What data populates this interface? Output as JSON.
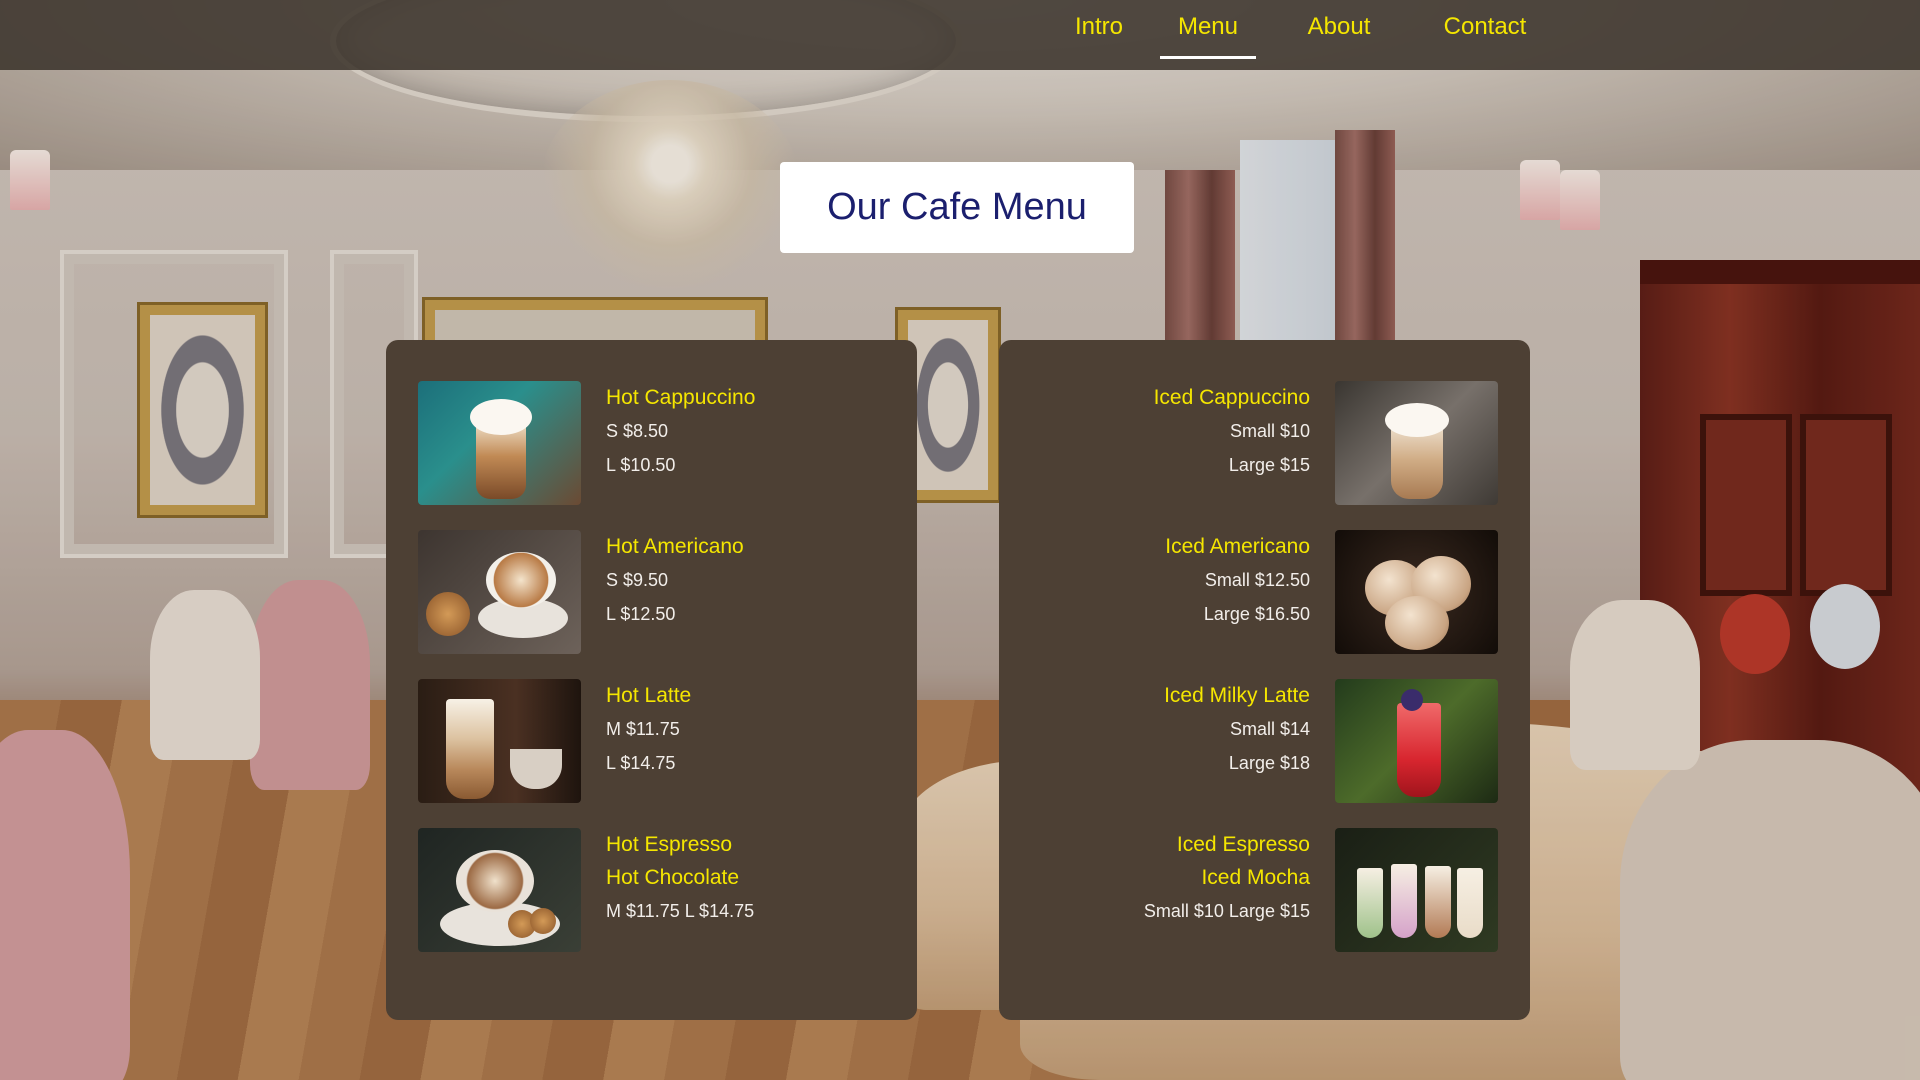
{
  "nav": {
    "items": [
      {
        "label": "Intro",
        "active": false
      },
      {
        "label": "Menu",
        "active": true
      },
      {
        "label": "About",
        "active": false
      },
      {
        "label": "Contact",
        "active": false
      }
    ]
  },
  "title": "Our Cafe Menu",
  "colors": {
    "accent_yellow": "#f5e600",
    "card_bg": "#4d4034",
    "title_text": "#1b1f6e",
    "nav_bg": "#3c342c"
  },
  "menu": {
    "hot": [
      {
        "names": [
          "Hot Cappuccino"
        ],
        "prices": [
          "S $8.50",
          "L $10.50"
        ],
        "image": "iced-cappuccino-whipped-cream"
      },
      {
        "names": [
          "Hot Americano"
        ],
        "prices": [
          "S $9.50",
          "L $12.50"
        ],
        "image": "latte-art-cup-with-cookie"
      },
      {
        "names": [
          "Hot Latte"
        ],
        "prices": [
          "M $11.75",
          "L $14.75"
        ],
        "image": "latte-glass-and-cup"
      },
      {
        "names": [
          "Hot Espresso",
          "Hot Chocolate"
        ],
        "prices": [
          "M $11.75 L $14.75"
        ],
        "image": "cocoa-cup-with-cookies"
      }
    ],
    "iced": [
      {
        "names": [
          "Iced Cappuccino"
        ],
        "prices": [
          "Small $10",
          "Large $15"
        ],
        "image": "iced-cappuccino-glass"
      },
      {
        "names": [
          "Iced Americano"
        ],
        "prices": [
          "Small $12.50",
          "Large $16.50"
        ],
        "image": "ice-cream-scoops-bowl"
      },
      {
        "names": [
          "Iced Milky Latte"
        ],
        "prices": [
          "Small $14",
          "Large $18"
        ],
        "image": "red-fruit-smoothie"
      },
      {
        "names": [
          "Iced Espresso",
          "Iced Mocha"
        ],
        "prices": [
          "Small $10 Large $15"
        ],
        "image": "milkshake-glasses"
      }
    ]
  }
}
